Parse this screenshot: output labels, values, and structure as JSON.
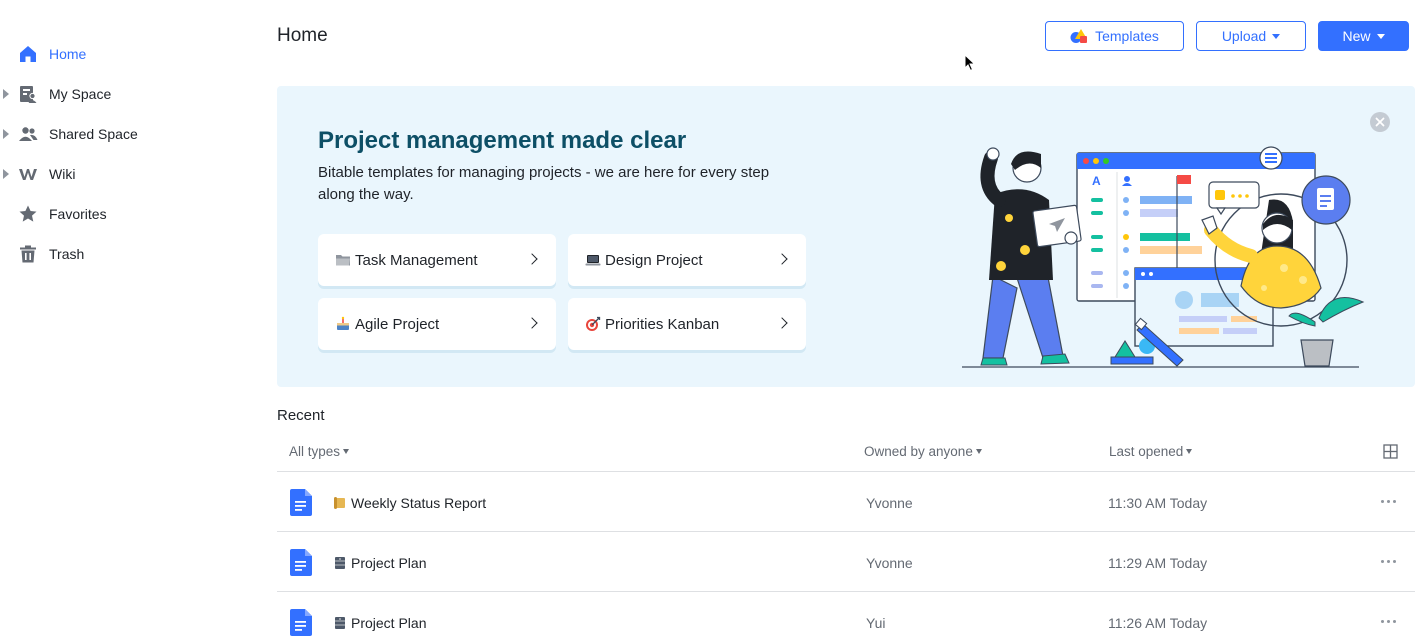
{
  "sidebar": {
    "items": [
      {
        "label": "Home",
        "icon": "home-icon",
        "active": true,
        "expandable": false
      },
      {
        "label": "My Space",
        "icon": "my-space-icon",
        "active": false,
        "expandable": true
      },
      {
        "label": "Shared Space",
        "icon": "users-icon",
        "active": false,
        "expandable": true
      },
      {
        "label": "Wiki",
        "icon": "wiki-icon",
        "active": false,
        "expandable": true
      },
      {
        "label": "Favorites",
        "icon": "star-icon",
        "active": false,
        "expandable": false
      },
      {
        "label": "Trash",
        "icon": "trash-icon",
        "active": false,
        "expandable": false
      }
    ]
  },
  "header": {
    "title": "Home",
    "templates_label": "Templates",
    "upload_label": "Upload",
    "new_label": "New"
  },
  "banner": {
    "title": "Project management made clear",
    "subtitle": "Bitable templates for managing projects - we are here for every step along the way.",
    "templates": [
      {
        "label": "Task Management",
        "icon": "folder-emoji-icon"
      },
      {
        "label": "Design Project",
        "icon": "laptop-emoji-icon"
      },
      {
        "label": "Agile Project",
        "icon": "cake-emoji-icon"
      },
      {
        "label": "Priorities Kanban",
        "icon": "target-emoji-icon"
      }
    ]
  },
  "recent": {
    "title": "Recent",
    "columns": {
      "type": "All types",
      "owner": "Owned by anyone",
      "opened": "Last opened"
    },
    "rows": [
      {
        "name": "Weekly Status Report",
        "owner": "Yvonne",
        "time": "11:30 AM Today",
        "icon": "scroll-emoji-icon"
      },
      {
        "name": "Project Plan",
        "owner": "Yvonne",
        "time": "11:29 AM Today",
        "icon": "cabinet-emoji-icon"
      },
      {
        "name": "Project Plan",
        "owner": "Yui",
        "time": "11:26 AM Today",
        "icon": "cabinet-emoji-icon"
      }
    ]
  },
  "colors": {
    "accent": "#3370ff",
    "banner_bg": "#eaf6fd",
    "banner_title": "#0d4f66",
    "doc_blue": "#3370ff"
  }
}
